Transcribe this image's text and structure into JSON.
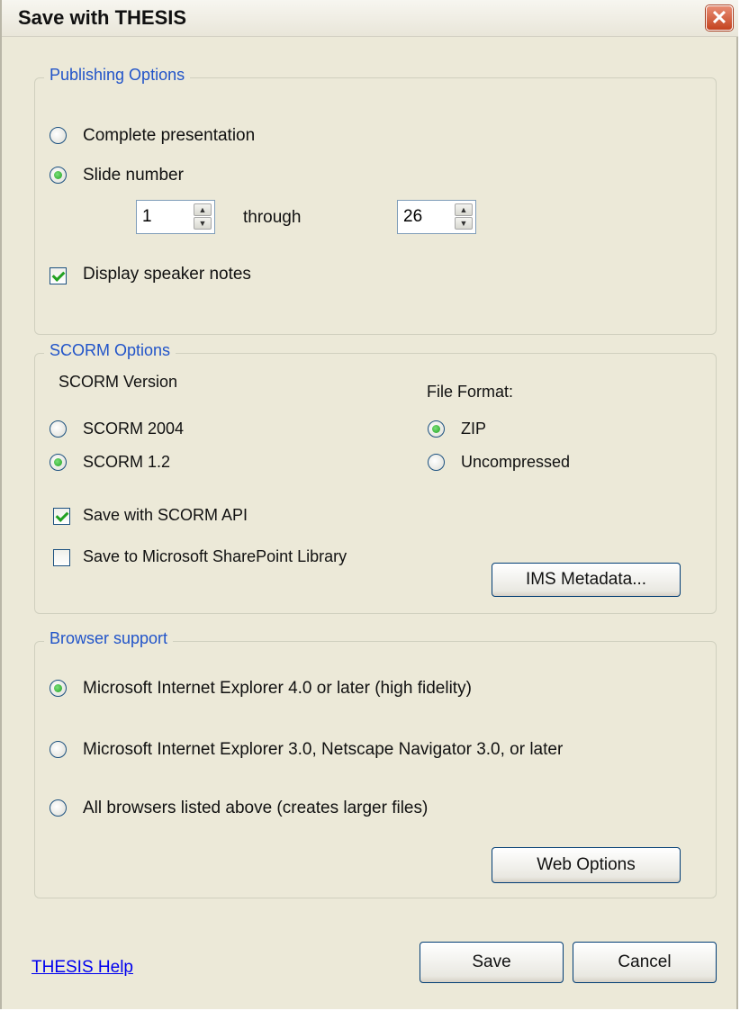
{
  "window": {
    "title": "Save with THESIS",
    "close_glyph": "✕"
  },
  "publishing": {
    "legend": "Publishing Options",
    "complete_label": "Complete presentation",
    "complete_selected": false,
    "slide_label": "Slide number",
    "slide_selected": true,
    "from_value": "1",
    "through_label": "through",
    "to_value": "26",
    "speaker_notes_label": "Display speaker notes",
    "speaker_notes_checked": true
  },
  "scorm": {
    "legend": "SCORM Options",
    "version_heading": "SCORM Version",
    "v2004_label": "SCORM 2004",
    "v2004_selected": false,
    "v12_label": "SCORM 1.2",
    "v12_selected": true,
    "format_heading": "File Format:",
    "zip_label": "ZIP",
    "zip_selected": true,
    "uncompressed_label": "Uncompressed",
    "uncompressed_selected": false,
    "api_label": "Save with SCORM API",
    "api_checked": true,
    "sharepoint_label": "Save to Microsoft SharePoint Library",
    "sharepoint_checked": false,
    "metadata_button": "IMS Metadata..."
  },
  "browser": {
    "legend": "Browser support",
    "ie4_label": "Microsoft Internet Explorer 4.0 or later (high fidelity)",
    "ie4_selected": true,
    "ie3_label": "Microsoft Internet Explorer 3.0, Netscape Navigator 3.0, or later",
    "ie3_selected": false,
    "all_label": "All browsers listed above (creates larger files)",
    "all_selected": false,
    "web_options_button": "Web Options"
  },
  "footer": {
    "help_link": "THESIS Help",
    "save_button": "Save",
    "cancel_button": "Cancel"
  },
  "colors": {
    "dialog_bg": "#ece9d8",
    "legend_text": "#2154c9",
    "close_red": "#c4431f",
    "check_green": "#21a121",
    "link_blue": "#0000ee"
  }
}
